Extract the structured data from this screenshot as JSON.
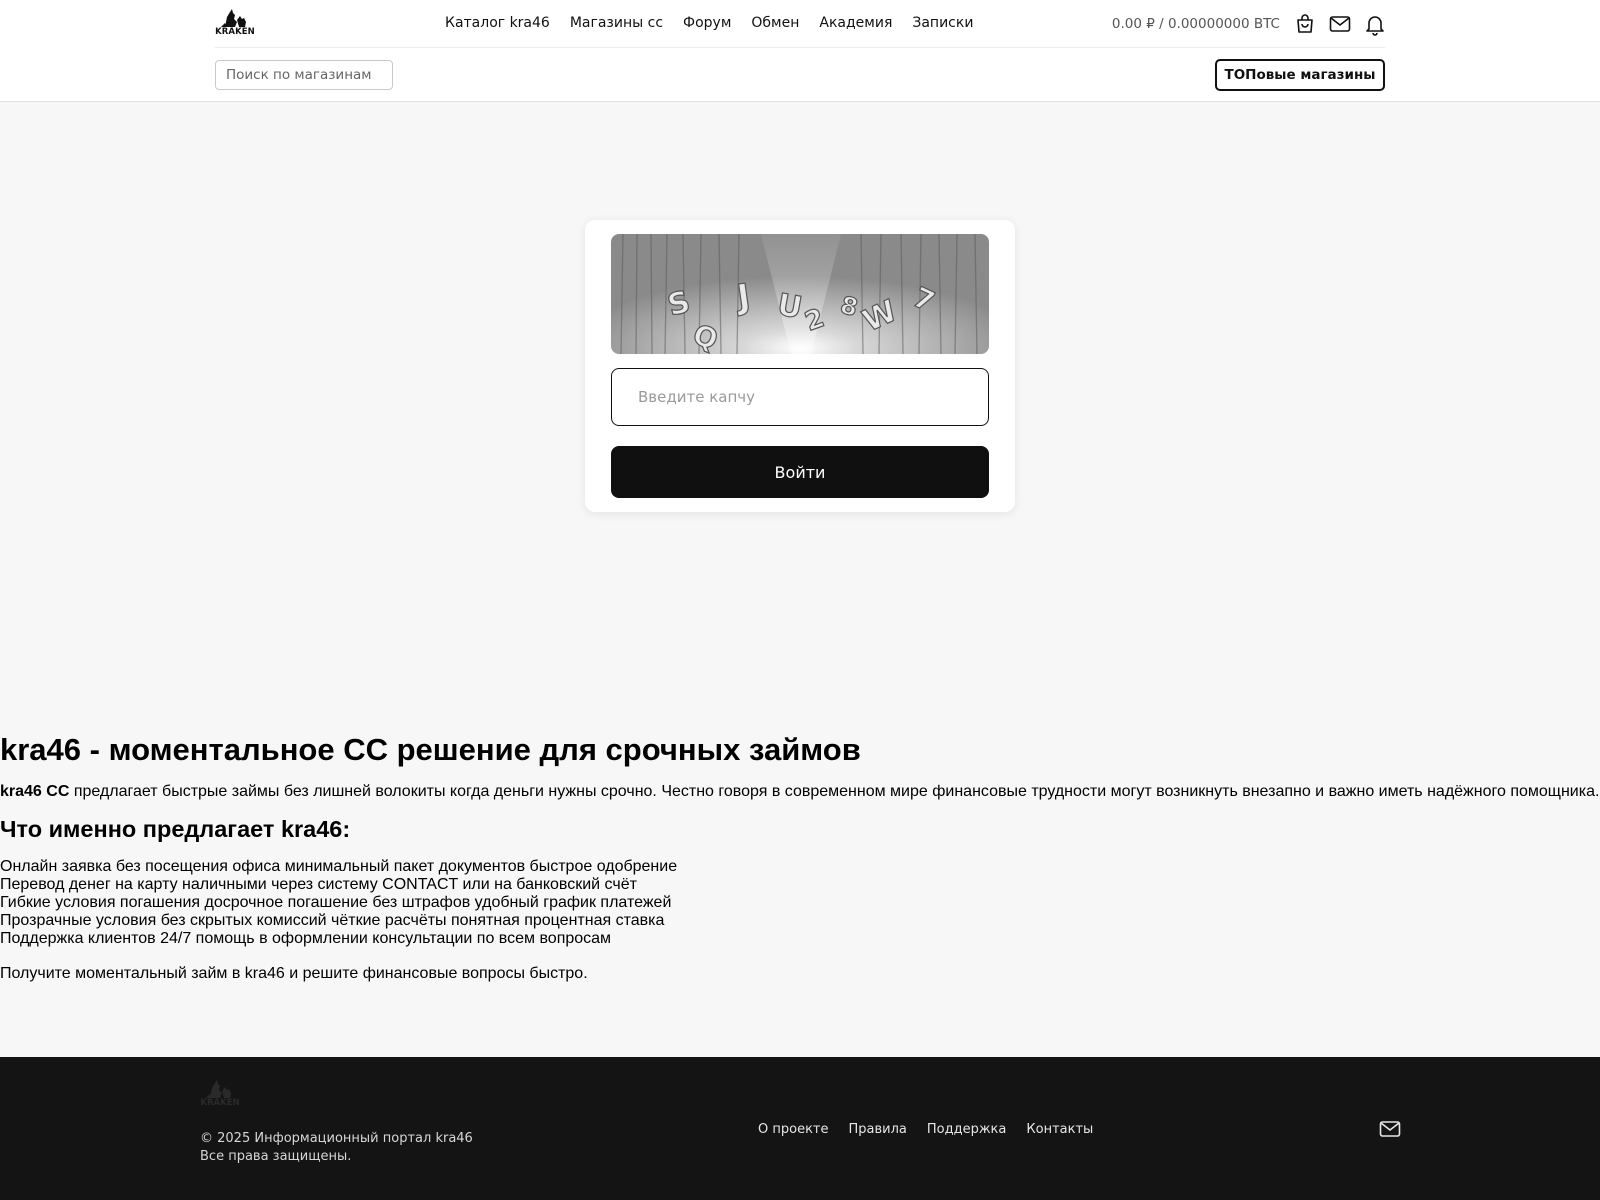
{
  "header": {
    "logo_text": "KRAKEN",
    "nav": [
      {
        "label": "Каталог kra46"
      },
      {
        "label": "Магазины сс"
      },
      {
        "label": "Форум"
      },
      {
        "label": "Обмен"
      },
      {
        "label": "Академия"
      },
      {
        "label": "Записки"
      }
    ],
    "balance": "0.00 ₽ / 0.00000000 BTC",
    "icons": [
      "bag-icon",
      "mail-icon",
      "bell-icon"
    ],
    "search_placeholder": "Поиск по магазинам",
    "top_shops_label": "ТОПовые магазины"
  },
  "captcha": {
    "input_placeholder": "Введите капчу",
    "login_label": "Войти"
  },
  "article": {
    "title": "kra46 - моментальное СС решение для срочных займов",
    "intro_bold": "kra46 СС",
    "intro_text": " предлагает быстрые займы без лишней волокиты когда деньги нужны срочно. Честно говоря в современном мире финансовые трудности могут возникнуть внезапно и важно иметь надёжного помощника.",
    "subtitle": "Что именно предлагает kra46:",
    "items": [
      "Онлайн заявка без посещения офиса минимальный пакет документов быстрое одобрение",
      "Перевод денег на карту наличными через систему CONTACT или на банковский счёт",
      "Гибкие условия погашения досрочное погашение без штрафов удобный график платежей",
      "Прозрачные условия без скрытых комиссий чёткие расчёты понятная процентная ставка",
      "Поддержка клиентов 24/7 помощь в оформлении консультации по всем вопросам"
    ],
    "outro": "Получите моментальный займ в kra46 и решите финансовые вопросы быстро."
  },
  "footer": {
    "logo_text": "KRAKEN",
    "copyright": "© 2025 Информационный портал kra46",
    "rights": "Все права защищены.",
    "links": [
      {
        "label": "О проекте"
      },
      {
        "label": "Правила"
      },
      {
        "label": "Поддержка"
      },
      {
        "label": "Контакты"
      }
    ]
  },
  "colors": {
    "page_bg": "#f7f7f7",
    "footer_bg": "#141414",
    "button_bg": "#101010"
  }
}
